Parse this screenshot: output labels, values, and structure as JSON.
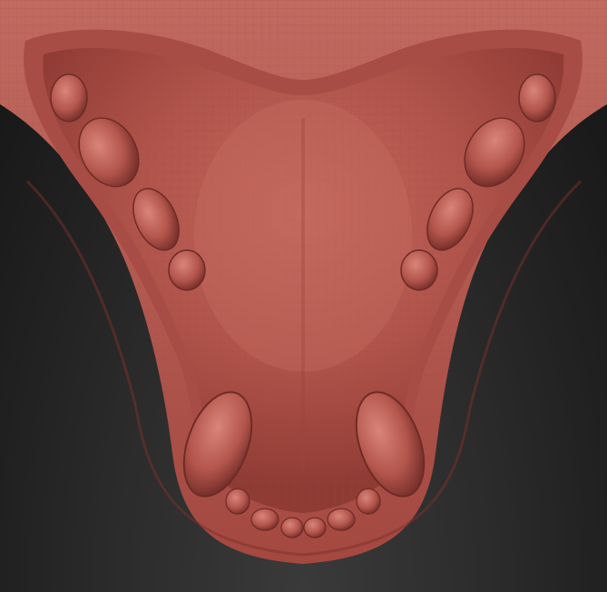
{
  "viewport": {
    "background_top": "#121212",
    "background_bottom": "#3a3a3a"
  },
  "model": {
    "material_color": "#b3554c",
    "highlight_color": "#d98579",
    "shadow_color": "#6e2b26",
    "wire_color": "#9c4a42"
  }
}
